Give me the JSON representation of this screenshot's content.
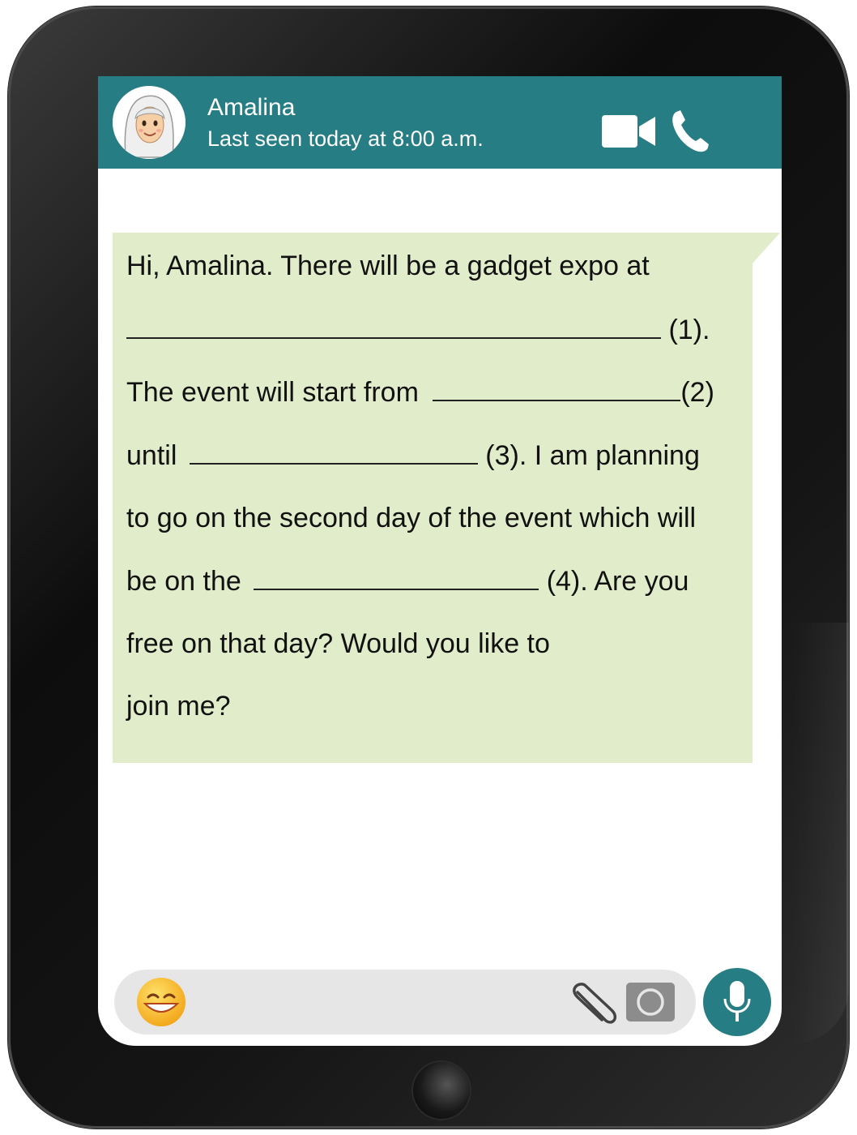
{
  "header": {
    "contact_name": "Amalina",
    "last_seen": "Last seen today at 8:00 a.m.",
    "color": "#267d83"
  },
  "message": {
    "bubble_color": "#e1ecca",
    "line1": "Hi,  Amalina. There will be a gadget expo at",
    "marker1": "(1).",
    "line3_prefix": "The  event will start from",
    "marker2": "(2)",
    "line4_prefix": "until",
    "marker3": "(3). I am planning",
    "line5": "to go on the second day of the event which will",
    "line6_prefix": "be on the",
    "marker4": "(4). Are you",
    "line7": "free on that day? Would you like to",
    "line8": "join me?"
  },
  "icons": {
    "video": "video-camera-icon",
    "call": "phone-icon",
    "emoji": "smiley-emoji-icon",
    "attach": "paperclip-icon",
    "camera": "camera-icon",
    "mic": "microphone-icon"
  }
}
